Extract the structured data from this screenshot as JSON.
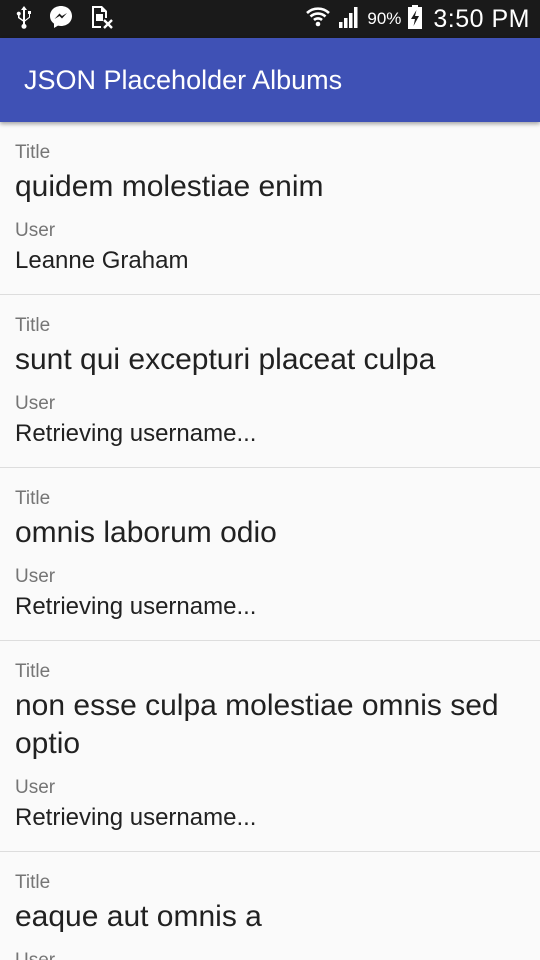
{
  "status_bar": {
    "icons_left": [
      "usb-icon",
      "messenger-icon",
      "sim-card-icon"
    ],
    "icons_right": [
      "wifi-icon",
      "signal-icon"
    ],
    "battery_percent": "90%",
    "battery_icon": "battery-charging-icon",
    "time": "3:50 PM"
  },
  "app_bar": {
    "title": "JSON Placeholder Albums",
    "color": "#3f51b5"
  },
  "albums": [
    {
      "title_label": "Title",
      "title": "quidem molestiae enim",
      "user_label": "User",
      "user": "Leanne Graham"
    },
    {
      "title_label": "Title",
      "title": "sunt qui excepturi placeat culpa",
      "user_label": "User",
      "user": "Retrieving username..."
    },
    {
      "title_label": "Title",
      "title": "omnis laborum odio",
      "user_label": "User",
      "user": "Retrieving username..."
    },
    {
      "title_label": "Title",
      "title": "non esse culpa molestiae omnis sed optio",
      "user_label": "User",
      "user": "Retrieving username..."
    },
    {
      "title_label": "Title",
      "title": "eaque aut omnis a",
      "user_label": "User",
      "user": ""
    }
  ]
}
